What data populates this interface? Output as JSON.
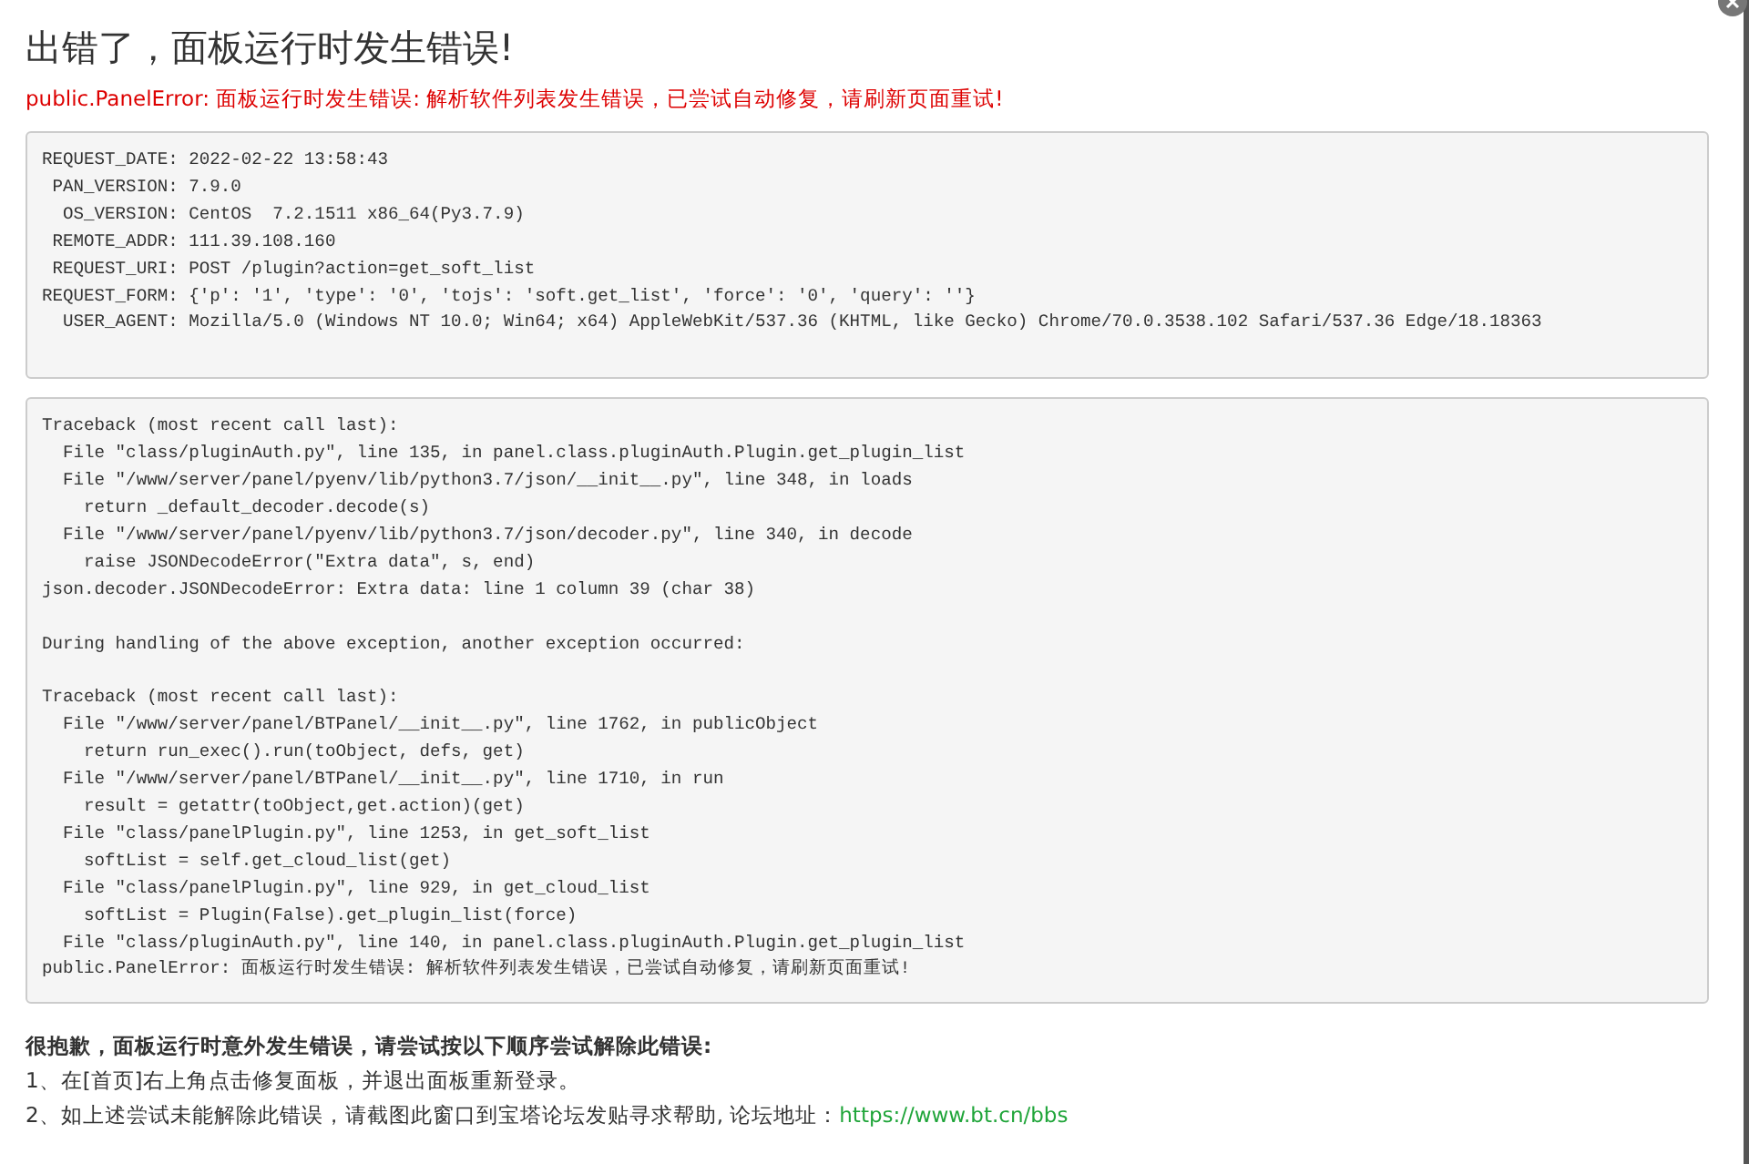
{
  "title": "出错了，面板运行时发生错误!",
  "error_message": "public.PanelError: 面板运行时发生错误: 解析软件列表发生错误，已尝试自动修复，请刷新页面重试!",
  "request_info": [
    "REQUEST_DATE: 2022-02-22 13:58:43",
    " PAN_VERSION: 7.9.0",
    "  OS_VERSION: CentOS  7.2.1511 x86_64(Py3.7.9)",
    " REMOTE_ADDR: 111.39.108.160",
    " REQUEST_URI: POST /plugin?action=get_soft_list",
    "REQUEST_FORM: {'p': '1', 'type': '0', 'tojs': 'soft.get_list', 'force': '0', 'query': ''}",
    "  USER_AGENT: Mozilla/5.0 (Windows NT 10.0; Win64; x64) AppleWebKit/537.36 (KHTML, like Gecko) Chrome/70.0.3538.102 Safari/537.36 Edge/18.18363"
  ],
  "traceback": [
    [
      "Traceback (most recent call last):",
      "  File \"class/pluginAuth.py\", line 135, in panel.class.pluginAuth.Plugin.get_plugin_list",
      "  File \"/www/server/panel/pyenv/lib/python3.7/json/__init__.py\", line 348, in loads",
      "    return _default_decoder.decode(s)",
      "  File \"/www/server/panel/pyenv/lib/python3.7/json/decoder.py\", line 340, in decode",
      "    raise JSONDecodeError(\"Extra data\", s, end)",
      "json.decoder.JSONDecodeError: Extra data: line 1 column 39 (char 38)"
    ],
    [
      "During handling of the above exception, another exception occurred:"
    ],
    [
      "Traceback (most recent call last):",
      "  File \"/www/server/panel/BTPanel/__init__.py\", line 1762, in publicObject",
      "    return run_exec().run(toObject, defs, get)",
      "  File \"/www/server/panel/BTPanel/__init__.py\", line 1710, in run",
      "    result = getattr(toObject,get.action)(get)",
      "  File \"class/panelPlugin.py\", line 1253, in get_soft_list",
      "    softList = self.get_cloud_list(get)",
      "  File \"class/panelPlugin.py\", line 929, in get_cloud_list",
      "    softList = Plugin(False).get_plugin_list(force)",
      "  File \"class/pluginAuth.py\", line 140, in panel.class.pluginAuth.Plugin.get_plugin_list",
      "public.PanelError: 面板运行时发生错误: 解析软件列表发生错误，已尝试自动修复，请刷新页面重试!"
    ]
  ],
  "help": {
    "heading": "很抱歉，面板运行时意外发生错误，请尝试按以下顺序尝试解除此错误:",
    "steps": [
      {
        "text": "1、在[首页]右上角点击修复面板，并退出面板重新登录。"
      },
      {
        "text": "2、如上述尝试未能解除此错误，请截图此窗口到宝塔论坛发贴寻求帮助, 论坛地址：",
        "link": "https://www.bt.cn/bbs"
      }
    ]
  }
}
